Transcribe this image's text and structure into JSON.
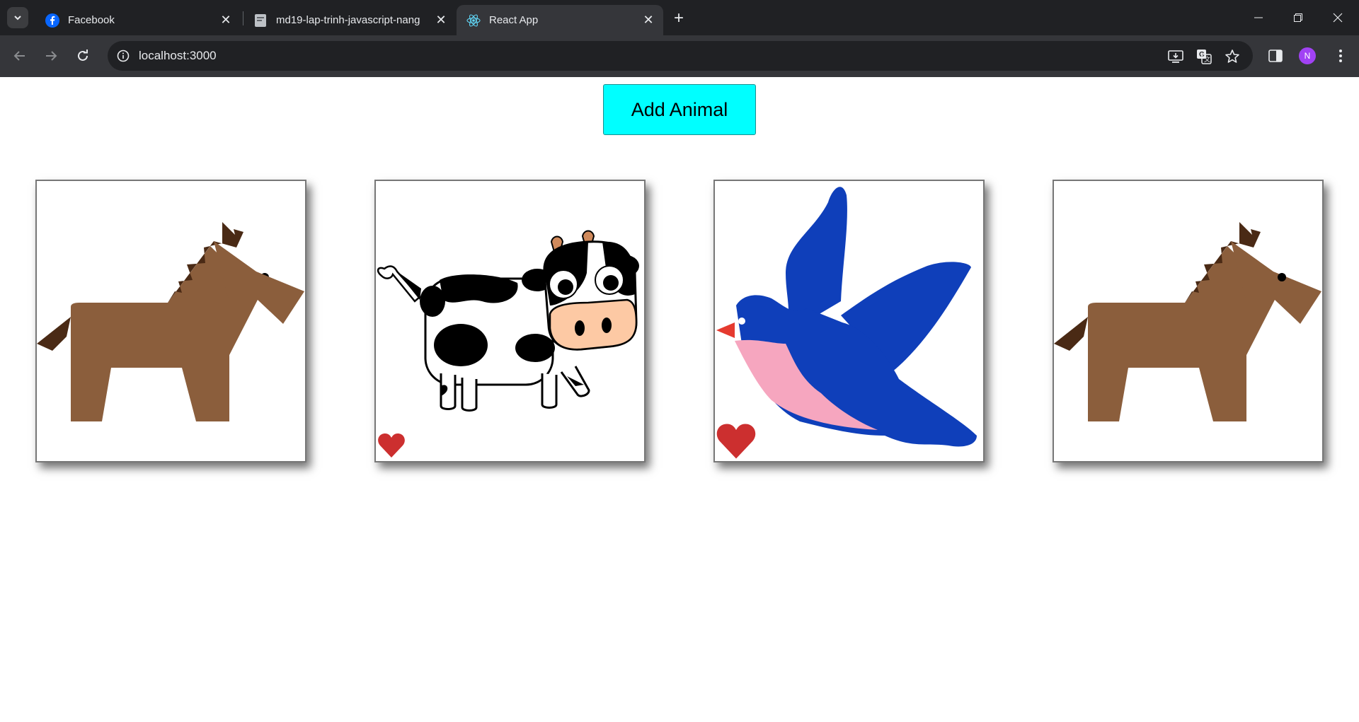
{
  "browser": {
    "tabs": [
      {
        "title": "Facebook",
        "favicon": "facebook-icon",
        "active": false
      },
      {
        "title": "md19-lap-trinh-javascript-nang",
        "favicon": "document-icon",
        "active": false
      },
      {
        "title": "React App",
        "favicon": "react-icon",
        "active": true
      }
    ],
    "url": "localhost:3000",
    "profile_initial": "N",
    "profile_color": "#a142f4"
  },
  "app": {
    "add_button_label": "Add Animal",
    "add_button_color": "#00ffff",
    "animals": [
      {
        "type": "horse",
        "liked": false
      },
      {
        "type": "cow",
        "liked": true
      },
      {
        "type": "bird",
        "liked": true
      },
      {
        "type": "horse",
        "liked": false
      }
    ],
    "heart_color": "#cc2f2f"
  }
}
